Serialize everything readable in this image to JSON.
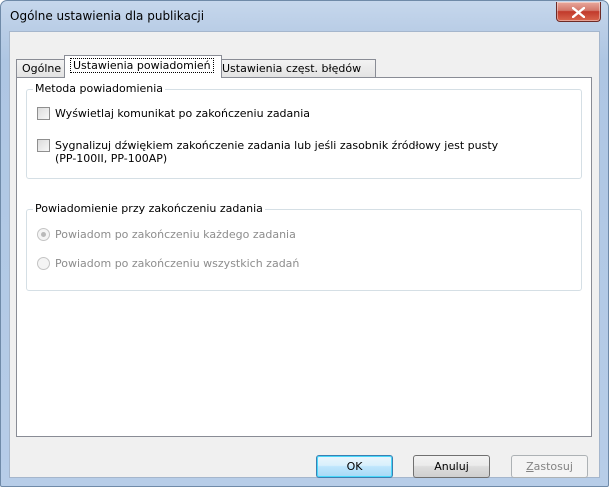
{
  "window": {
    "title": "Ogólne ustawienia dla publikacji"
  },
  "tabs": [
    {
      "label": "Ogólne"
    },
    {
      "label": "Ustawienia powiadomień"
    },
    {
      "label": "Ustawienia częst. błędów"
    }
  ],
  "group1": {
    "title": "Metoda powiadomienia",
    "options": [
      {
        "label": "Wyświetlaj komunikat po zakończeniu zadania",
        "checked": false
      },
      {
        "label": "Sygnalizuj dźwiękiem zakończenie zadania lub jeśli zasobnik źródłowy jest pusty",
        "label2": "(PP-100II, PP-100AP)",
        "checked": false
      }
    ]
  },
  "group2": {
    "title": "Powiadomienie przy zakończeniu zadania",
    "options": [
      {
        "label": "Powiadom po zakończeniu każdego zadania",
        "selected": true,
        "enabled": false
      },
      {
        "label": "Powiadom po zakończeniu wszystkich zadań",
        "selected": false,
        "enabled": false
      }
    ]
  },
  "buttons": {
    "ok": "OK",
    "cancel": "Anuluj",
    "apply": "Zastosuj"
  },
  "colors": {
    "titlebar": "#b9cde6",
    "close": "#c1392b",
    "default_button": "#3c7fb1"
  }
}
